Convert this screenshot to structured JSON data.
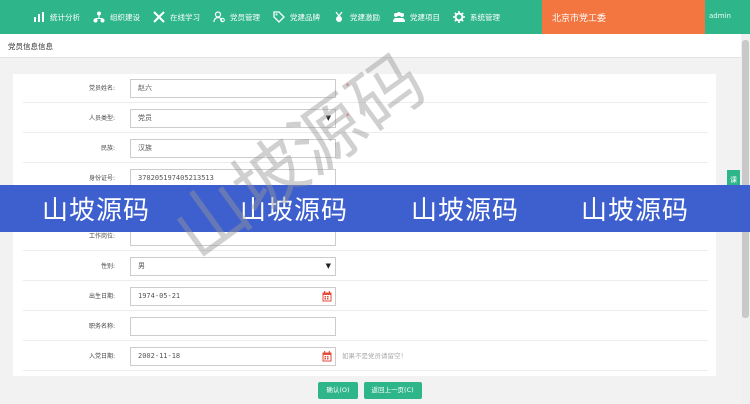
{
  "nav": {
    "items": [
      {
        "label": "统计分析",
        "icon": "bar-chart-icon"
      },
      {
        "label": "组织建设",
        "icon": "org-tree-icon"
      },
      {
        "label": "在线学习",
        "icon": "tools-icon"
      },
      {
        "label": "党员管理",
        "icon": "member-icon"
      },
      {
        "label": "党建品牌",
        "icon": "tag-icon"
      },
      {
        "label": "党建激励",
        "icon": "medal-icon"
      },
      {
        "label": "党建项目",
        "icon": "group-icon"
      },
      {
        "label": "系统管理",
        "icon": "gear-icon"
      }
    ],
    "city": "北京市党工委",
    "user": "admin"
  },
  "page_title": "党员信息信息",
  "form": {
    "name": {
      "label": "党员姓名:",
      "value": "赵六"
    },
    "person_type": {
      "label": "人员类型:",
      "value": "党员"
    },
    "ethnicity": {
      "label": "民族:",
      "value": "汉族"
    },
    "id_number": {
      "label": "身份证号:",
      "value": "370205197405213513"
    },
    "work_unit": {
      "label": "工作岗位:",
      "value": ""
    },
    "gender": {
      "label": "性别:",
      "value": "男"
    },
    "birth_date": {
      "label": "出生日期:",
      "value": "1974-05-21"
    },
    "position": {
      "label": "职务名称:",
      "value": ""
    },
    "join_date": {
      "label": "入党日期:",
      "value": "2002-11-18",
      "hint": "如果不是党员请留空！"
    }
  },
  "buttons": {
    "confirm": "确认(O)",
    "back": "返回上一页(C)"
  },
  "side_tab": "课",
  "watermark": {
    "text": "山坡源码"
  }
}
